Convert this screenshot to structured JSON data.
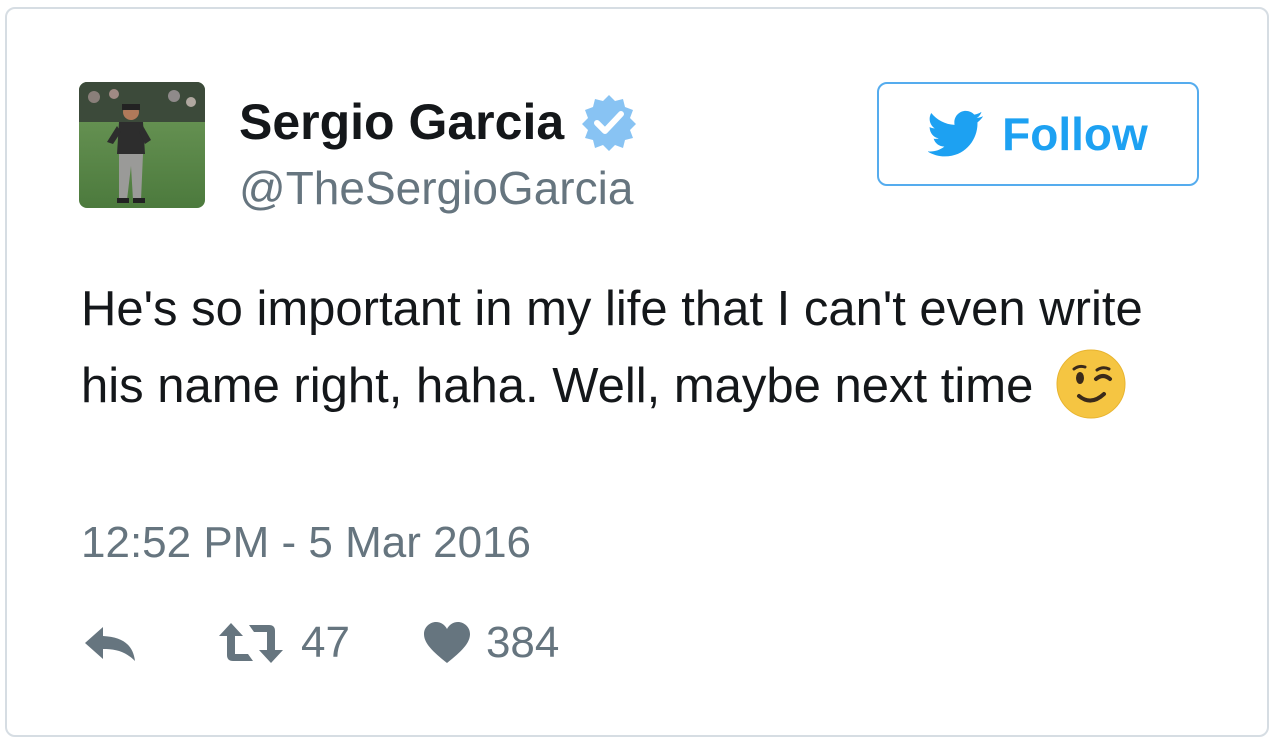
{
  "tweet": {
    "author": {
      "display_name": "Sergio Garcia",
      "handle": "@TheSergioGarcia",
      "verified": true,
      "avatar_icon": "golfer-photo-avatar"
    },
    "follow_button": {
      "label": "Follow",
      "icon": "twitter-bird-icon"
    },
    "text_line": "He's so important in my life that I can't even write his name right, haha. Well, maybe next time",
    "emoji": "winking-face-emoji",
    "timestamp": "12:52 PM - 5 Mar 2016",
    "actions": {
      "reply_icon": "reply-icon",
      "retweets": "47",
      "likes": "384"
    }
  },
  "colors": {
    "accent": "#1da1f2",
    "text": "#14171a",
    "muted": "#66757f",
    "border": "#d6dde3",
    "verified": "#1da1f2",
    "emoji": "#f5c542"
  }
}
